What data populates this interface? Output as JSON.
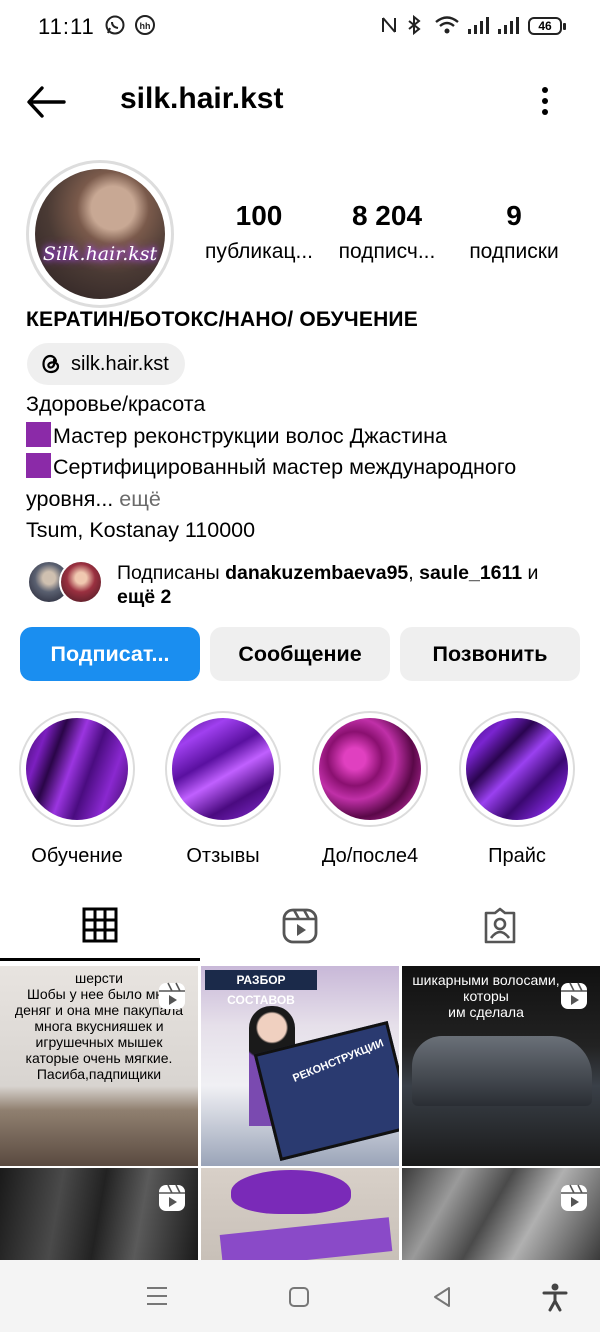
{
  "status_bar": {
    "time": "11:11",
    "battery": "46"
  },
  "header": {
    "username": "silk.hair.kst"
  },
  "profile": {
    "avatar_text": "Silk.hair.kst",
    "stats": [
      {
        "value": "100",
        "label": "публикац..."
      },
      {
        "value": "8 204",
        "label": "подписч..."
      },
      {
        "value": "9",
        "label": "подписки"
      }
    ],
    "bio_title": "КЕРАТИН/БОТОКС/НАНО/ ОБУЧЕНИЕ",
    "threads_handle": "silk.hair.kst",
    "bio_lines": [
      "Здоровье/красота",
      "Мастер реконструкции волос Джастина",
      "Сертифицированный мастер международного",
      "уровня...",
      "ещё",
      "Tsum, Kostanay 110000"
    ],
    "followed_by": {
      "prefix": "Подписаны",
      "user1": "danakuzembaeva95",
      "user2": "saule_1611",
      "joiner": "и",
      "rest": "ещё 2"
    }
  },
  "buttons": {
    "follow": "Подписат...",
    "message": "Сообщение",
    "call": "Позвонить"
  },
  "highlights": [
    {
      "label": "Обучение"
    },
    {
      "label": "Отзывы"
    },
    {
      "label": "До/после4"
    },
    {
      "label": "Прайс"
    }
  ],
  "tabs": [
    "grid-icon",
    "reels-icon",
    "tagged-icon"
  ],
  "grid": {
    "post1_caption": [
      "шерсти",
      "Шобы у нее было мно",
      "деняг и она мне пакупала",
      "многа вкуснияшек и",
      "игрушечных мышек",
      "каторые очень мягкие.",
      "Пасиба,падпищики"
    ],
    "post2_caption": [
      "РАЗБОР СОСТАВОВ",
      "РЕКОНСТРУКЦИИ"
    ],
    "post3_caption": [
      "шикарными волосами, которы",
      "им сделала"
    ]
  }
}
